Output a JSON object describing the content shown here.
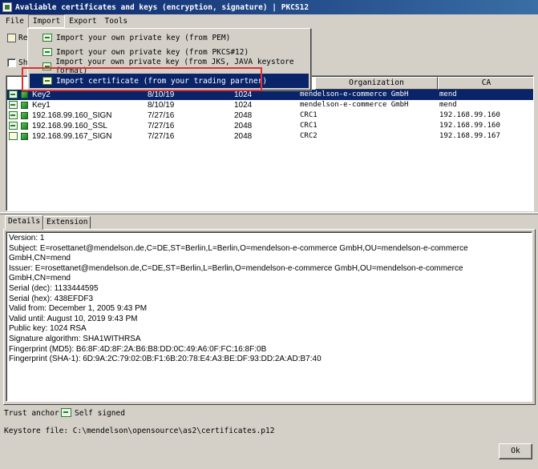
{
  "window": {
    "title": "Avaliable certificates and keys (encryption, signature) | PKCS12"
  },
  "menubar": [
    "File",
    "Import",
    "Export",
    "Tools"
  ],
  "toolbar": {
    "button_label": "Re",
    "checkbox_label": "Sh"
  },
  "import_menu": [
    {
      "label": "Import your own private key (from PEM)",
      "icon": "key-icon"
    },
    {
      "label": "Import your own private key (from PKCS#12)",
      "icon": "key-icon"
    },
    {
      "label": "Import your own private key (from JKS, JAVA keystore format)",
      "icon": "key-icon"
    },
    {
      "label": "Import certificate (from your trading partner)",
      "icon": "certificate-icon",
      "selected": true
    }
  ],
  "table": {
    "columns": [
      "Organization",
      "CA"
    ],
    "rows": [
      {
        "alias": "Key2",
        "date": "8/10/19",
        "length": "1024",
        "org": "mendelson-e-commerce GmbH",
        "ca": "mend",
        "icon": "key-icon",
        "selected": true
      },
      {
        "alias": "Key1",
        "date": "8/10/19",
        "length": "1024",
        "org": "mendelson-e-commerce GmbH",
        "ca": "mend",
        "icon": "key-icon"
      },
      {
        "alias": "192.168.99.160_SIGN",
        "date": "7/27/16",
        "length": "2048",
        "org": "CRC1",
        "ca": "192.168.99.160",
        "icon": "key-icon"
      },
      {
        "alias": "192.168.99.160_SSL",
        "date": "7/27/16",
        "length": "2048",
        "org": "CRC1",
        "ca": "192.168.99.160",
        "icon": "key-icon"
      },
      {
        "alias": "192.168.99.167_SIGN",
        "date": "7/27/16",
        "length": "2048",
        "org": "CRC2",
        "ca": "192.168.99.167",
        "icon": "certificate-icon"
      }
    ]
  },
  "tabs": [
    "Details",
    "Extension"
  ],
  "details": [
    "Version: 1",
    "Subject: E=rosettanet@mendelson.de,C=DE,ST=Berlin,L=Berlin,O=mendelson-e-commerce GmbH,OU=mendelson-e-commerce",
    "GmbH,CN=mend",
    "Issuer: E=rosettanet@mendelson.de,C=DE,ST=Berlin,L=Berlin,O=mendelson-e-commerce GmbH,OU=mendelson-e-commerce",
    "GmbH,CN=mend",
    "Serial (dec): 1133444595",
    "Serial (hex): 438EFDF3",
    "Valid from: December 1, 2005 9:43 PM",
    "Valid until: August 10, 2019 9:43 PM",
    "Public key: 1024 RSA",
    "Signature algorithm: SHA1WITHRSA",
    "Fingerprint (MD5): B6:8F:4D:8F:2A:B6:B8:DD:0C:49:A6:0F:FC:16:8F:0B",
    "Fingerprint (SHA-1): 6D:9A:2C:79:02:0B:F1:6B:20:78:E4:A3:BE:DF:93:DD:2A:AD:B7:40"
  ],
  "footer": {
    "trust_anchor_label": "Trust anchor:",
    "trust_anchor_value": "Self signed",
    "keystore_label": "Keystore file: C:\\mendelson\\opensource\\as2\\certificates.p12",
    "ok_label": "Ok"
  },
  "colors": {
    "selection": "#0a246a",
    "highlight_box": "#e03030",
    "window_bg": "#d4d0c8"
  }
}
